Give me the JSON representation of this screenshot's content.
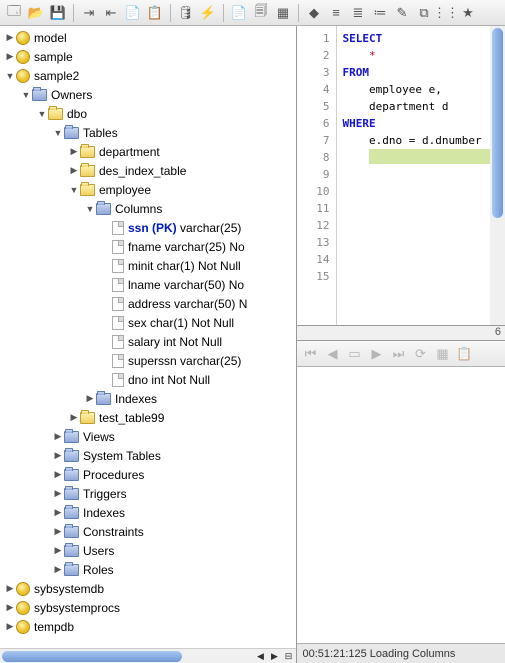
{
  "toolbar": {
    "items": [
      {
        "name": "new-connection",
        "glyph": "🗔"
      },
      {
        "name": "open",
        "glyph": "📂"
      },
      {
        "name": "save",
        "glyph": "💾"
      },
      {
        "sep": true
      },
      {
        "name": "import",
        "glyph": "⇥"
      },
      {
        "name": "export",
        "glyph": "⇤"
      },
      {
        "name": "copy",
        "glyph": "📄"
      },
      {
        "name": "paste",
        "glyph": "📋"
      },
      {
        "sep": true
      },
      {
        "name": "db",
        "glyph": "🛢"
      },
      {
        "name": "run",
        "glyph": "⚡"
      },
      {
        "sep": true
      },
      {
        "name": "sheet",
        "glyph": "📄"
      },
      {
        "name": "props",
        "glyph": "🗐"
      },
      {
        "name": "grid",
        "glyph": "▦"
      },
      {
        "sep": true
      },
      {
        "name": "book",
        "glyph": "◆"
      },
      {
        "name": "outdent",
        "glyph": "≡"
      },
      {
        "name": "indent",
        "glyph": "≣"
      },
      {
        "name": "align",
        "glyph": "≔"
      },
      {
        "name": "wand",
        "glyph": "✎"
      },
      {
        "name": "format",
        "glyph": "⧉"
      },
      {
        "name": "sort",
        "glyph": "⋮⋮"
      },
      {
        "name": "star",
        "glyph": "★"
      }
    ]
  },
  "tree": {
    "nodes": [
      {
        "depth": 0,
        "toggle": "▶",
        "icon": "db",
        "label": "model"
      },
      {
        "depth": 0,
        "toggle": "▶",
        "icon": "db",
        "label": "sample"
      },
      {
        "depth": 0,
        "toggle": "▼",
        "icon": "db",
        "label": "sample2"
      },
      {
        "depth": 1,
        "toggle": "▼",
        "icon": "folder-blue",
        "label": "Owners"
      },
      {
        "depth": 2,
        "toggle": "▼",
        "icon": "folder",
        "label": "dbo"
      },
      {
        "depth": 3,
        "toggle": "▼",
        "icon": "folder-blue",
        "label": "Tables"
      },
      {
        "depth": 4,
        "toggle": "▶",
        "icon": "folder",
        "label": "department"
      },
      {
        "depth": 4,
        "toggle": "▶",
        "icon": "folder",
        "label": "des_index_table"
      },
      {
        "depth": 4,
        "toggle": "▼",
        "icon": "folder",
        "label": "employee"
      },
      {
        "depth": 5,
        "toggle": "▼",
        "icon": "folder-blue",
        "label": "Columns"
      },
      {
        "depth": 6,
        "toggle": "",
        "icon": "file",
        "label": "ssn (PK)",
        "pk": true,
        "suffix": " varchar(25)"
      },
      {
        "depth": 6,
        "toggle": "",
        "icon": "file",
        "label": "fname varchar(25) No"
      },
      {
        "depth": 6,
        "toggle": "",
        "icon": "file",
        "label": "minit char(1) Not Null"
      },
      {
        "depth": 6,
        "toggle": "",
        "icon": "file",
        "label": "lname varchar(50) No"
      },
      {
        "depth": 6,
        "toggle": "",
        "icon": "file",
        "label": "address varchar(50) N"
      },
      {
        "depth": 6,
        "toggle": "",
        "icon": "file",
        "label": "sex char(1) Not Null"
      },
      {
        "depth": 6,
        "toggle": "",
        "icon": "file",
        "label": "salary int Not Null"
      },
      {
        "depth": 6,
        "toggle": "",
        "icon": "file",
        "label": "superssn varchar(25) "
      },
      {
        "depth": 6,
        "toggle": "",
        "icon": "file",
        "label": "dno int Not Null"
      },
      {
        "depth": 5,
        "toggle": "▶",
        "icon": "folder-blue",
        "label": "Indexes"
      },
      {
        "depth": 4,
        "toggle": "▶",
        "icon": "folder",
        "label": "test_table99"
      },
      {
        "depth": 3,
        "toggle": "▶",
        "icon": "folder-blue",
        "label": "Views"
      },
      {
        "depth": 3,
        "toggle": "▶",
        "icon": "folder-blue",
        "label": "System Tables"
      },
      {
        "depth": 3,
        "toggle": "▶",
        "icon": "folder-blue",
        "label": "Procedures"
      },
      {
        "depth": 3,
        "toggle": "▶",
        "icon": "folder-blue",
        "label": "Triggers"
      },
      {
        "depth": 3,
        "toggle": "▶",
        "icon": "folder-blue",
        "label": "Indexes"
      },
      {
        "depth": 3,
        "toggle": "▶",
        "icon": "folder-blue",
        "label": "Constraints"
      },
      {
        "depth": 3,
        "toggle": "▶",
        "icon": "folder-blue",
        "label": "Users"
      },
      {
        "depth": 3,
        "toggle": "▶",
        "icon": "folder-blue",
        "label": "Roles"
      },
      {
        "depth": 0,
        "toggle": "▶",
        "icon": "db",
        "label": "sybsystemdb"
      },
      {
        "depth": 0,
        "toggle": "▶",
        "icon": "db",
        "label": "sybsystemprocs"
      },
      {
        "depth": 0,
        "toggle": "▶",
        "icon": "db",
        "label": "tempdb"
      }
    ]
  },
  "editor": {
    "line_count": 15,
    "lines": [
      {
        "t": "SELECT",
        "cls": "kw"
      },
      {
        "t": "    *",
        "cls": "star",
        "pre": "    "
      },
      {
        "t": "FROM",
        "cls": "kw"
      },
      {
        "t": "    employee e,",
        "cls": ""
      },
      {
        "t": "    department d",
        "cls": ""
      },
      {
        "t": "WHERE",
        "cls": "kw"
      },
      {
        "t": "    e.dno = d.dnumber",
        "cls": ""
      },
      {
        "t": "",
        "cls": "hl"
      },
      {
        "t": "",
        "cls": ""
      },
      {
        "t": "",
        "cls": ""
      },
      {
        "t": "",
        "cls": ""
      },
      {
        "t": "",
        "cls": ""
      },
      {
        "t": "",
        "cls": ""
      },
      {
        "t": "",
        "cls": ""
      },
      {
        "t": "",
        "cls": ""
      }
    ],
    "cursor_col": "6"
  },
  "results_toolbar": {
    "items": [
      {
        "name": "first",
        "glyph": "⏮"
      },
      {
        "name": "prev",
        "glyph": "◀"
      },
      {
        "name": "page",
        "glyph": "▭"
      },
      {
        "name": "next",
        "glyph": "▶"
      },
      {
        "name": "last",
        "glyph": "⏭"
      },
      {
        "name": "refresh",
        "glyph": "⟳"
      },
      {
        "name": "export",
        "glyph": "▦"
      },
      {
        "name": "copy",
        "glyph": "📋"
      }
    ]
  },
  "status": {
    "text": "00:51:21:125 Loading Columns"
  }
}
